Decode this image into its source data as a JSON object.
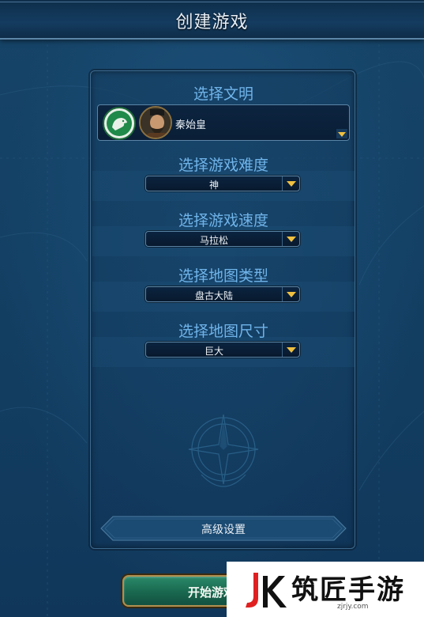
{
  "window": {
    "title": "创建游戏"
  },
  "civilization": {
    "label": "选择文明",
    "selected": "秦始皇",
    "emblem_icon": "dragon-emblem-icon",
    "leader_icon": "leader-portrait-icon"
  },
  "difficulty": {
    "label": "选择游戏难度",
    "value": "神"
  },
  "speed": {
    "label": "选择游戏速度",
    "value": "马拉松"
  },
  "map_type": {
    "label": "选择地图类型",
    "value": "盘古大陆"
  },
  "map_size": {
    "label": "选择地图尺寸",
    "value": "巨大"
  },
  "advanced": {
    "label": "高级设置"
  },
  "start": {
    "label": "开始游戏"
  },
  "watermark": {
    "text": "筑匠手游",
    "sub": "zjrjy.com"
  },
  "colors": {
    "accent_label": "#6fb4ea",
    "dropdown_arrow": "#f0c040",
    "start_button": "#1a6a50"
  }
}
